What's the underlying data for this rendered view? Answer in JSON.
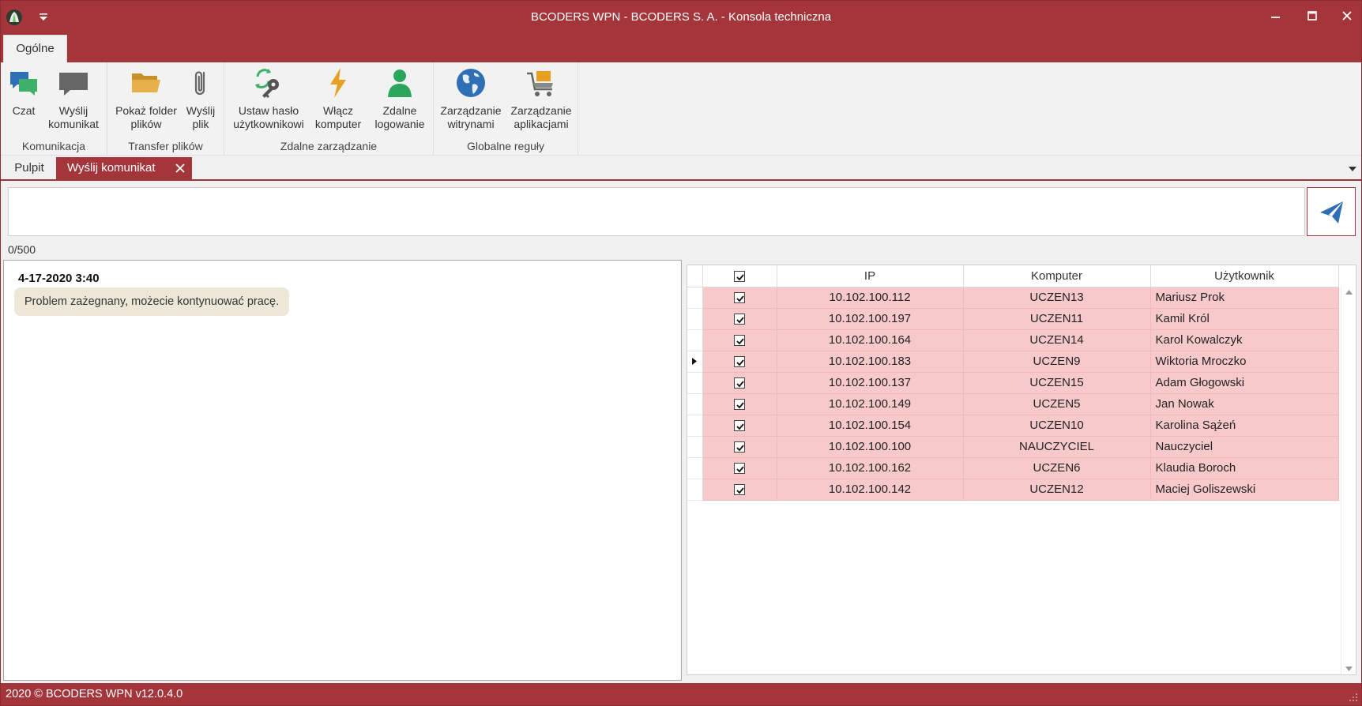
{
  "window": {
    "title": "BCODERS WPN - BCODERS S. A. - Konsola techniczna",
    "accent_color": "#a4363b"
  },
  "ribbon": {
    "tab_label": "Ogólne",
    "groups": [
      {
        "label": "Komunikacja",
        "buttons": [
          {
            "label": "Czat",
            "icon": "chat-icon"
          },
          {
            "label": "Wyślij\nkomunikat",
            "icon": "message-icon"
          }
        ]
      },
      {
        "label": "Transfer plików",
        "buttons": [
          {
            "label": "Pokaż folder\nplików",
            "icon": "folder-icon"
          },
          {
            "label": "Wyślij\nplik",
            "icon": "paperclip-icon"
          }
        ]
      },
      {
        "label": "Zdalne zarządzanie",
        "buttons": [
          {
            "label": "Ustaw hasło\nużytkownikowi",
            "icon": "key-refresh-icon"
          },
          {
            "label": "Włącz\nkomputer",
            "icon": "lightning-icon"
          },
          {
            "label": "Zdalne\nlogowanie",
            "icon": "user-icon"
          }
        ]
      },
      {
        "label": "Globalne reguły",
        "buttons": [
          {
            "label": "Zarządzanie\nwitrynami",
            "icon": "globe-icon"
          },
          {
            "label": "Zarządzanie\naplikacjami",
            "icon": "cart-icon"
          }
        ]
      }
    ]
  },
  "doc_tabs": {
    "pulpit": "Pulpit",
    "active": "Wyślij komunikat"
  },
  "composer": {
    "value": "",
    "counter": "0/500"
  },
  "chat": {
    "timestamp": "4-17-2020 3:40",
    "message": "Problem zażegnany, możecie kontynuować pracę."
  },
  "grid": {
    "columns": [
      "IP",
      "Komputer",
      "Użytkownik"
    ],
    "header_checked": true,
    "current_row": 3,
    "rows": [
      {
        "checked": true,
        "ip": "10.102.100.112",
        "computer": "UCZEN13",
        "user": "Mariusz Prok"
      },
      {
        "checked": true,
        "ip": "10.102.100.197",
        "computer": "UCZEN11",
        "user": "Kamil Król"
      },
      {
        "checked": true,
        "ip": "10.102.100.164",
        "computer": "UCZEN14",
        "user": "Karol Kowalczyk"
      },
      {
        "checked": true,
        "ip": "10.102.100.183",
        "computer": "UCZEN9",
        "user": "Wiktoria Mroczko"
      },
      {
        "checked": true,
        "ip": "10.102.100.137",
        "computer": "UCZEN15",
        "user": "Adam Głogowski"
      },
      {
        "checked": true,
        "ip": "10.102.100.149",
        "computer": "UCZEN5",
        "user": "Jan Nowak"
      },
      {
        "checked": true,
        "ip": "10.102.100.154",
        "computer": "UCZEN10",
        "user": "Karolina Sążeń"
      },
      {
        "checked": true,
        "ip": "10.102.100.100",
        "computer": "NAUCZYCIEL",
        "user": "Nauczyciel"
      },
      {
        "checked": true,
        "ip": "10.102.100.162",
        "computer": "UCZEN6",
        "user": "Klaudia Boroch"
      },
      {
        "checked": true,
        "ip": "10.102.100.142",
        "computer": "UCZEN12",
        "user": "Maciej Goliszewski"
      }
    ]
  },
  "status": {
    "text": "2020 ©  BCODERS WPN v12.0.4.0"
  }
}
